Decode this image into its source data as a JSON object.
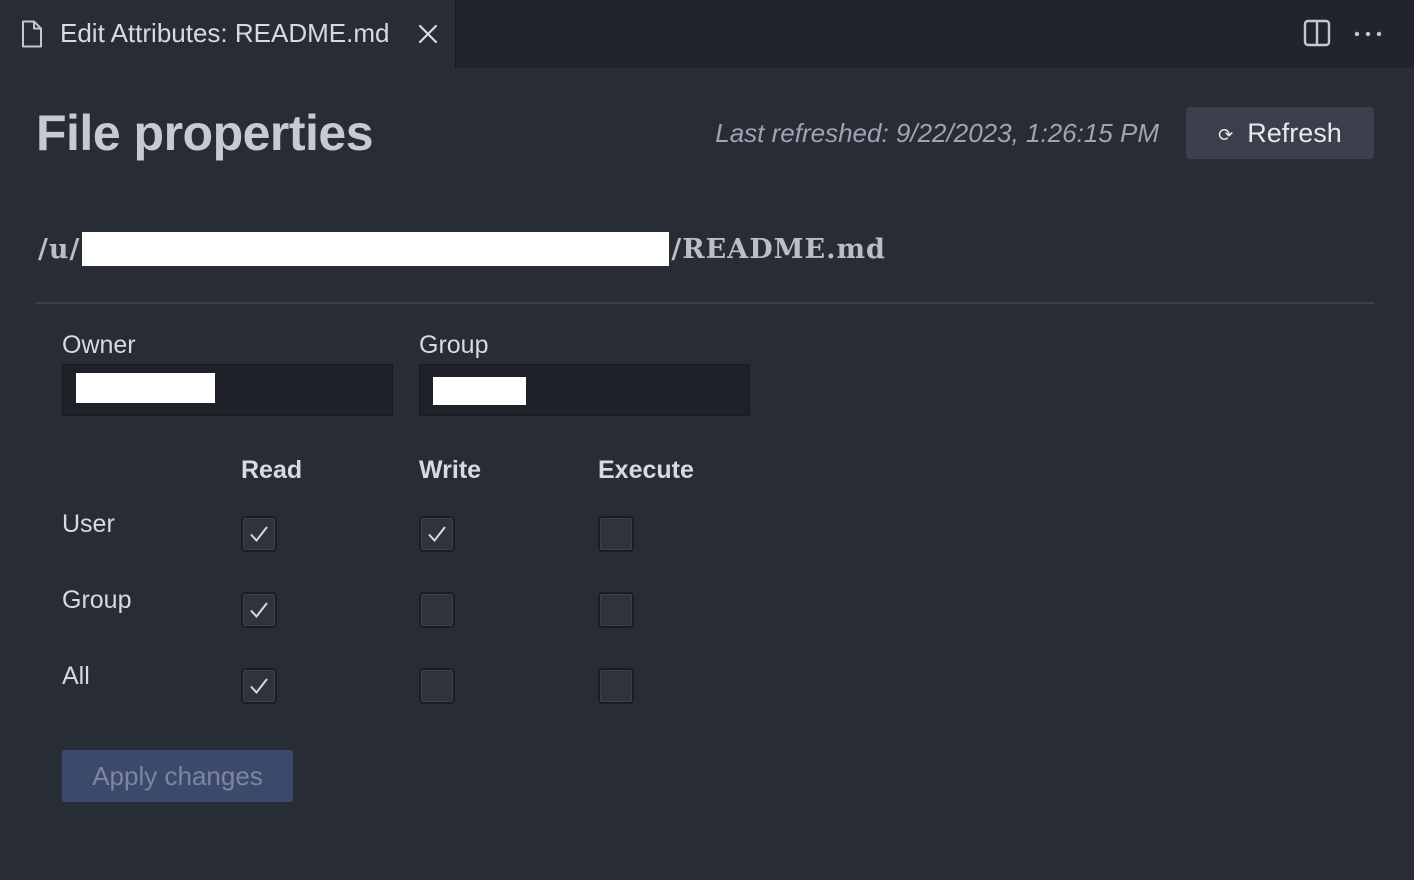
{
  "tab": {
    "label": "Edit Attributes: README.md",
    "file_icon": "file-icon",
    "close_icon": "close-icon"
  },
  "editor_actions": {
    "split_icon": "split-editor-icon",
    "more_icon": "more-actions-icon"
  },
  "header": {
    "title": "File properties",
    "last_refreshed": "Last refreshed: 9/22/2023, 1:26:15 PM",
    "refresh_label": "Refresh",
    "refresh_icon": "⟳"
  },
  "path": {
    "prefix": "/u/",
    "suffix": "/README.md"
  },
  "owner": {
    "label": "Owner",
    "value": ""
  },
  "group": {
    "label": "Group",
    "value": ""
  },
  "permissions": {
    "columns": [
      "Read",
      "Write",
      "Execute"
    ],
    "rows": [
      {
        "label": "User",
        "read": true,
        "write": true,
        "execute": false
      },
      {
        "label": "Group",
        "read": true,
        "write": false,
        "execute": false
      },
      {
        "label": "All",
        "read": true,
        "write": false,
        "execute": false
      }
    ]
  },
  "actions": {
    "apply_label": "Apply changes",
    "apply_enabled": false
  },
  "colors": {
    "background": "#282c34",
    "tab_bar": "#21252b",
    "input_bg": "#1e2127",
    "apply_button_bg": "#3b4a6b",
    "refresh_button_bg": "#3a3f4b"
  }
}
